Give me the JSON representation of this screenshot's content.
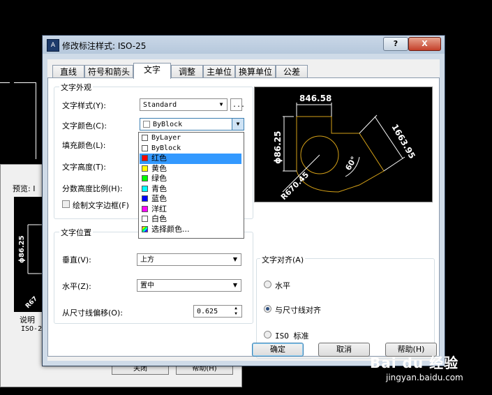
{
  "background_dialog": {
    "preview_label": "预览: I",
    "desc_label": "说明",
    "desc_value": "ISO-2",
    "close_label": "关闭",
    "help_label": "帮助(H)",
    "preview_dim": "ϕ86.25",
    "preview_dim2": "R67"
  },
  "dialog": {
    "app_icon": "A",
    "title": "修改标注样式: ISO-25",
    "help_glyph": "?",
    "close_glyph": "X",
    "tabs": [
      {
        "label": "直线",
        "active": false
      },
      {
        "label": "符号和箭头",
        "active": false
      },
      {
        "label": "文字",
        "active": true
      },
      {
        "label": "调整",
        "active": false
      },
      {
        "label": "主单位",
        "active": false
      },
      {
        "label": "换算单位",
        "active": false
      },
      {
        "label": "公差",
        "active": false
      }
    ],
    "appearance": {
      "title": "文字外观",
      "text_style_label": "文字样式(Y):",
      "text_style_value": "Standard",
      "browse_label": "...",
      "text_color_label": "文字颜色(C):",
      "text_color_value": "ByBlock",
      "fill_color_label": "填充颜色(L):",
      "text_height_label": "文字高度(T):",
      "fraction_scale_label": "分数高度比例(H):",
      "frame_label": "绘制文字边框(F)"
    },
    "color_options": [
      {
        "label": "ByLayer",
        "color": "#ffffff",
        "highlighted": false
      },
      {
        "label": "ByBlock",
        "color": "#ffffff",
        "highlighted": false
      },
      {
        "label": "红色",
        "color": "#ff0000",
        "highlighted": true
      },
      {
        "label": "黄色",
        "color": "#ffff00",
        "highlighted": false
      },
      {
        "label": "绿色",
        "color": "#00ff00",
        "highlighted": false
      },
      {
        "label": "青色",
        "color": "#00ffff",
        "highlighted": false
      },
      {
        "label": "蓝色",
        "color": "#0000ff",
        "highlighted": false
      },
      {
        "label": "洋红",
        "color": "#ff00ff",
        "highlighted": false
      },
      {
        "label": "白色",
        "color": "#ffffff",
        "highlighted": false
      },
      {
        "label": "选择颜色...",
        "color": "multi",
        "highlighted": false
      }
    ],
    "placement": {
      "title": "文字位置",
      "vertical_label": "垂直(V):",
      "vertical_value": "上方",
      "horizontal_label": "水平(Z):",
      "horizontal_value": "置中",
      "offset_label": "从尺寸线偏移(O):",
      "offset_value": "0.625"
    },
    "alignment": {
      "title": "文字对齐(A)",
      "options": [
        {
          "label": "水平",
          "selected": false
        },
        {
          "label": "与尺寸线对齐",
          "selected": true
        },
        {
          "label": "ISO 标准",
          "selected": false
        }
      ]
    },
    "preview": {
      "dim_top": "846.58",
      "dim_left": "ϕ86.25",
      "dim_right": "1663.95",
      "angle": "60°",
      "radius": "R670.45"
    },
    "buttons": {
      "ok": "确定",
      "cancel": "取消",
      "help": "帮助(H)"
    }
  },
  "watermark": {
    "logo": "Bai du 经验",
    "url": "jingyan.baidu.com"
  },
  "colors": {
    "dialog_frame": "#cfdbe8",
    "highlight": "#3399ff",
    "preview_dim_line": "#d4a017"
  }
}
